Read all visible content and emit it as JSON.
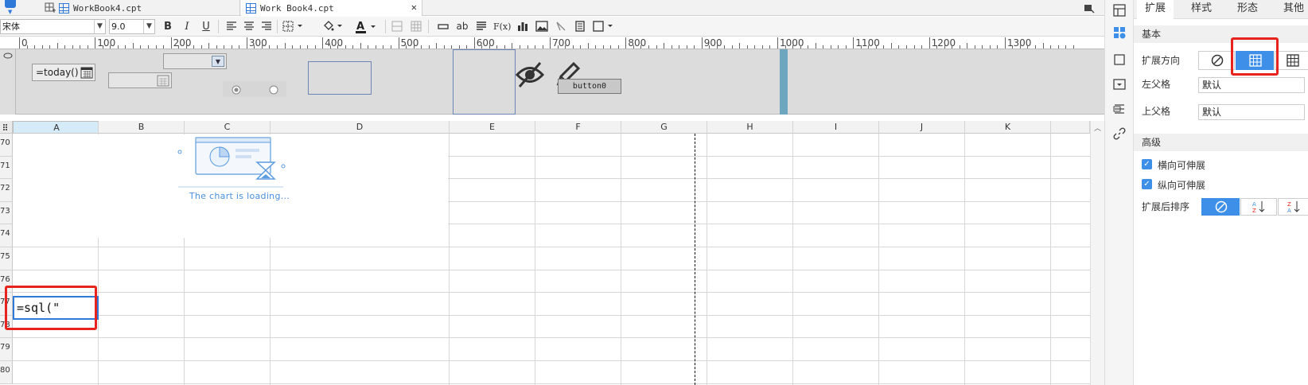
{
  "tabs": [
    {
      "label": "WorkBook4.cpt",
      "active": false
    },
    {
      "label": "Work Book4.cpt",
      "active": true
    }
  ],
  "toolbar": {
    "font_name": "宋体",
    "font_size": "9.0",
    "bold": "B",
    "italic": "I",
    "underline": "U",
    "ab_label": "ab",
    "formula_label": "F(x)"
  },
  "ruler": {
    "marks": [
      "0",
      "100",
      "200",
      "300",
      "400",
      "500",
      "600",
      "700",
      "800",
      "900",
      "1000",
      "1100",
      "1200",
      "1300"
    ]
  },
  "params": {
    "formula_widget": "=today()",
    "button_label": "button0"
  },
  "columns": [
    "A",
    "B",
    "C",
    "D",
    "E",
    "F",
    "G",
    "H",
    "I",
    "J",
    "K"
  ],
  "rows": [
    "70",
    "71",
    "72",
    "73",
    "74",
    "75",
    "76",
    "77",
    "78",
    "79",
    "80"
  ],
  "chart": {
    "loading_text": "The chart is loading..."
  },
  "cell_editor": {
    "value": "=sql(\""
  },
  "right_panel": {
    "tabs": [
      "扩展",
      "样式",
      "形态",
      "其他"
    ],
    "sections": {
      "basic": "基本",
      "advanced": "高级"
    },
    "expand_direction_label": "扩展方向",
    "left_parent_label": "左父格",
    "left_parent_value": "默认",
    "top_parent_label": "上父格",
    "top_parent_value": "默认",
    "horizontal_expandable": "横向可伸展",
    "vertical_expandable": "纵向可伸展",
    "sort_after_expand": "扩展后排序"
  },
  "colors": {
    "accent": "#3d8fe8",
    "highlight": "#e8221c"
  }
}
